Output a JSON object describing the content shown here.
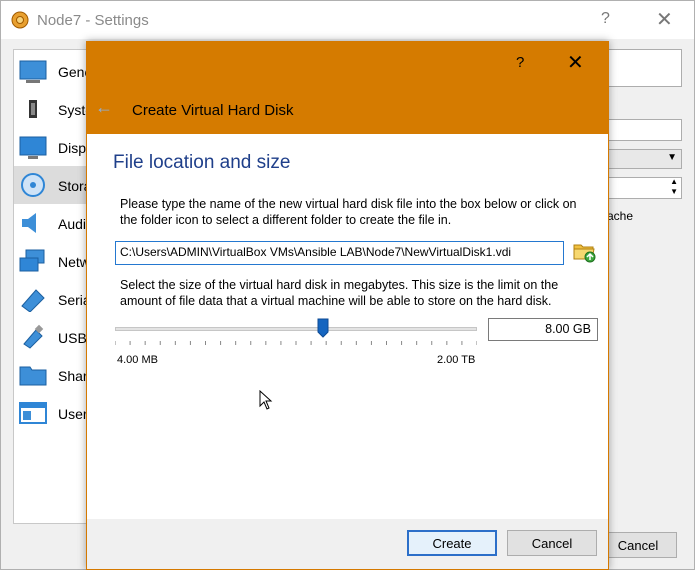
{
  "settings": {
    "title": "Node7 - Settings",
    "help": "?",
    "close": "✕",
    "sidebar": [
      {
        "label": "Gene",
        "icon": "general-icon"
      },
      {
        "label": "Syste",
        "icon": "system-icon"
      },
      {
        "label": "Disp",
        "icon": "display-icon"
      },
      {
        "label": "Stora",
        "icon": "storage-icon"
      },
      {
        "label": "Audi",
        "icon": "audio-icon"
      },
      {
        "label": "Netw",
        "icon": "network-icon"
      },
      {
        "label": "Seria",
        "icon": "serial-icon"
      },
      {
        "label": "USB",
        "icon": "usb-icon"
      },
      {
        "label": "Shar",
        "icon": "shared-folder-icon"
      },
      {
        "label": "User",
        "icon": "user-interface-icon"
      }
    ],
    "partial_text": "ache",
    "cancel_label": "Cancel"
  },
  "dialog": {
    "help": "?",
    "close": "✕",
    "back": "←",
    "title": "Create Virtual Hard Disk",
    "page_title": "File location and size",
    "location_desc": "Please type the name of the new virtual hard disk file into the box below or click on the folder icon to select a different folder to create the file in.",
    "path_value": "C:\\Users\\ADMIN\\VirtualBox VMs\\Ansible LAB\\Node7\\NewVirtualDisk1.vdi",
    "size_desc": "Select the size of the virtual hard disk in megabytes. This size is the limit on the amount of file data that a virtual machine will be able to store on the hard disk.",
    "size_value": "8.00 GB",
    "slider_fraction": 0.575,
    "min_label": "4.00 MB",
    "max_label": "2.00 TB",
    "create_label": "Create",
    "cancel_label": "Cancel"
  },
  "colors": {
    "header": "#d57b00",
    "accent": "#1f3f8a",
    "slider": "#1565c0"
  }
}
